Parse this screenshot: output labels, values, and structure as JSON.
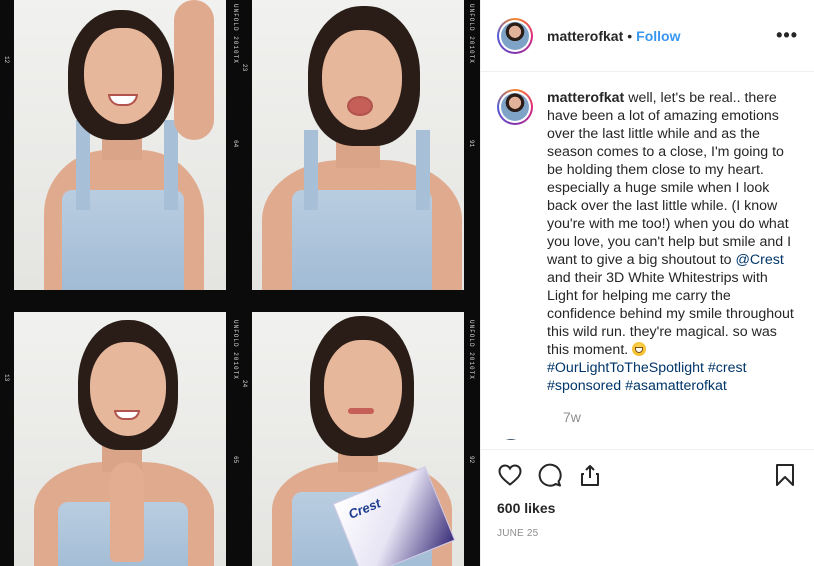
{
  "post": {
    "username": "matterofkat",
    "follow_label": "Follow",
    "dot": "•",
    "more_label": "•••",
    "caption_segments": [
      "well, let's be real.. there have been a lot of amazing emotions over the last little while and as the season comes to a close, I'm going to be holding them close to my heart. especially a huge smile when I look back over the last little while. (I know you're with me too!) when you do what you love, you can't help but smile and I want to give a big shoutout to ",
      "@Crest",
      " and their 3D White Whitestrips with Light for helping me carry the confidence behind my smile throughout this wild run. they're magical. so was this moment. ",
      "#OurLightToTheSpotlight",
      "#crest",
      "#sponsored",
      "#asamatterofkat"
    ],
    "time_ago": "7w",
    "likes": "600 likes",
    "date": "June 25"
  },
  "icons": {
    "like": "heart-icon",
    "comment": "comment-icon",
    "share": "share-icon",
    "save": "bookmark-icon",
    "emoji": "grinning-emoji"
  },
  "photo": {
    "film_labels": [
      "UNFOLD 2010TX",
      "UNFOLD 2010TX",
      "UNFOLD 2010TX",
      "UNFOLD 2010TX"
    ],
    "film_numbers": [
      "12",
      "23",
      "64",
      "13",
      "24",
      "65",
      "91",
      "92"
    ],
    "box_brand": "Crest"
  },
  "colors": {
    "accent": "#3897f0",
    "link": "#003569",
    "text": "#262626",
    "muted": "#8e8e8e"
  }
}
